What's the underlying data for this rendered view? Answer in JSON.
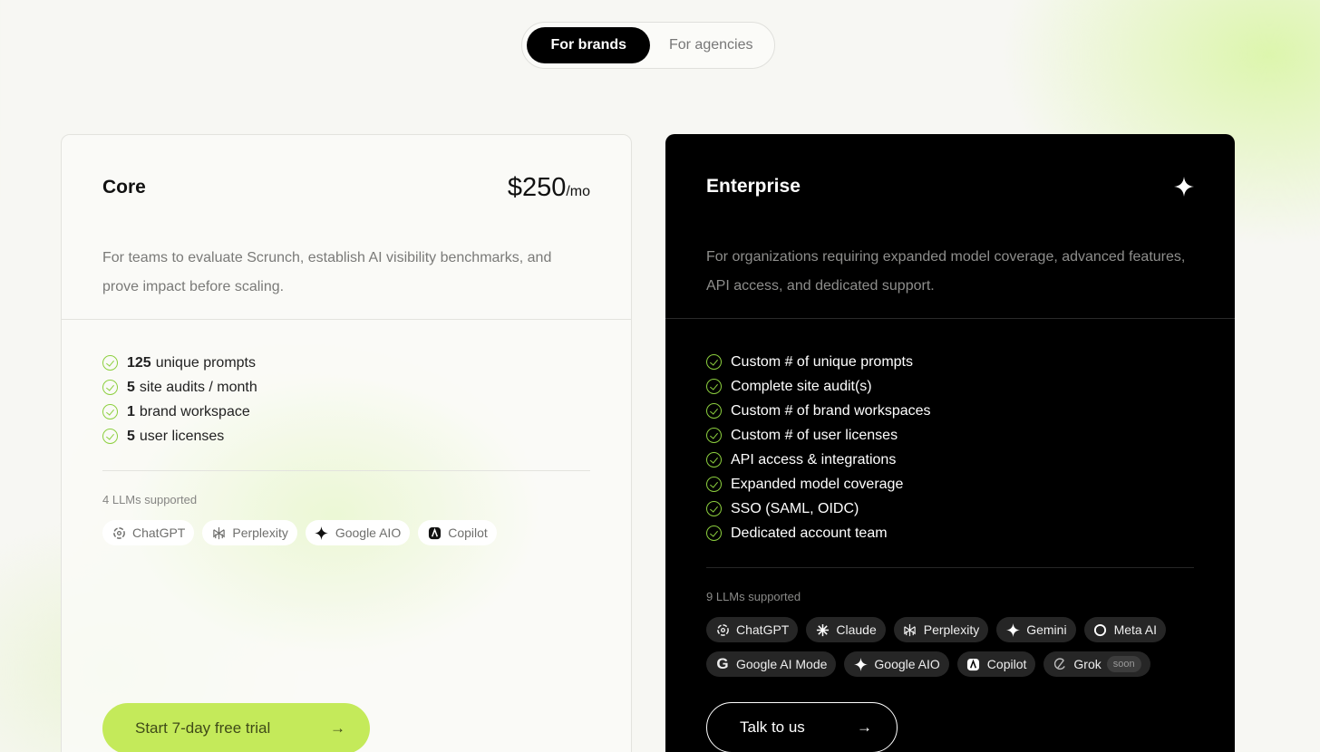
{
  "toggle": {
    "active": "For brands",
    "inactive": "For agencies"
  },
  "core": {
    "name": "Core",
    "price": "$250",
    "per": "/mo",
    "description": "For teams to evaluate Scrunch, establish AI visibility benchmarks, and prove impact before scaling.",
    "features": [
      {
        "num": "125",
        "text": "unique prompts"
      },
      {
        "num": "5",
        "text": "site audits / month"
      },
      {
        "num": "1",
        "text": "brand workspace"
      },
      {
        "num": "5",
        "text": "user licenses"
      }
    ],
    "llm_label": "4 LLMs supported",
    "llms": [
      {
        "name": "ChatGPT",
        "icon": "chatgpt-icon"
      },
      {
        "name": "Perplexity",
        "icon": "perplexity-icon"
      },
      {
        "name": "Google AIO",
        "icon": "sparkle-icon"
      },
      {
        "name": "Copilot",
        "icon": "copilot-icon"
      }
    ],
    "cta": "Start 7-day free trial",
    "accent": "#c4ea5a"
  },
  "enterprise": {
    "name": "Enterprise",
    "description": "For organizations requiring expanded model coverage, advanced features, API access, and dedicated support.",
    "features": [
      "Custom # of unique prompts",
      "Complete site audit(s)",
      "Custom # of brand workspaces",
      "Custom # of user licenses",
      "API access & integrations",
      "Expanded model coverage",
      "SSO (SAML, OIDC)",
      "Dedicated account team"
    ],
    "llm_label": "9 LLMs supported",
    "llms": [
      {
        "name": "ChatGPT",
        "icon": "chatgpt-icon"
      },
      {
        "name": "Claude",
        "icon": "claude-icon"
      },
      {
        "name": "Perplexity",
        "icon": "perplexity-icon"
      },
      {
        "name": "Gemini",
        "icon": "sparkle-icon"
      },
      {
        "name": "Meta AI",
        "icon": "meta-ai-icon"
      },
      {
        "name": "Google AI Mode",
        "icon": "google-icon"
      },
      {
        "name": "Google AIO",
        "icon": "sparkle-icon"
      },
      {
        "name": "Copilot",
        "icon": "copilot-icon"
      },
      {
        "name": "Grok",
        "icon": "grok-icon",
        "badge": "soon"
      }
    ],
    "cta": "Talk to us"
  }
}
